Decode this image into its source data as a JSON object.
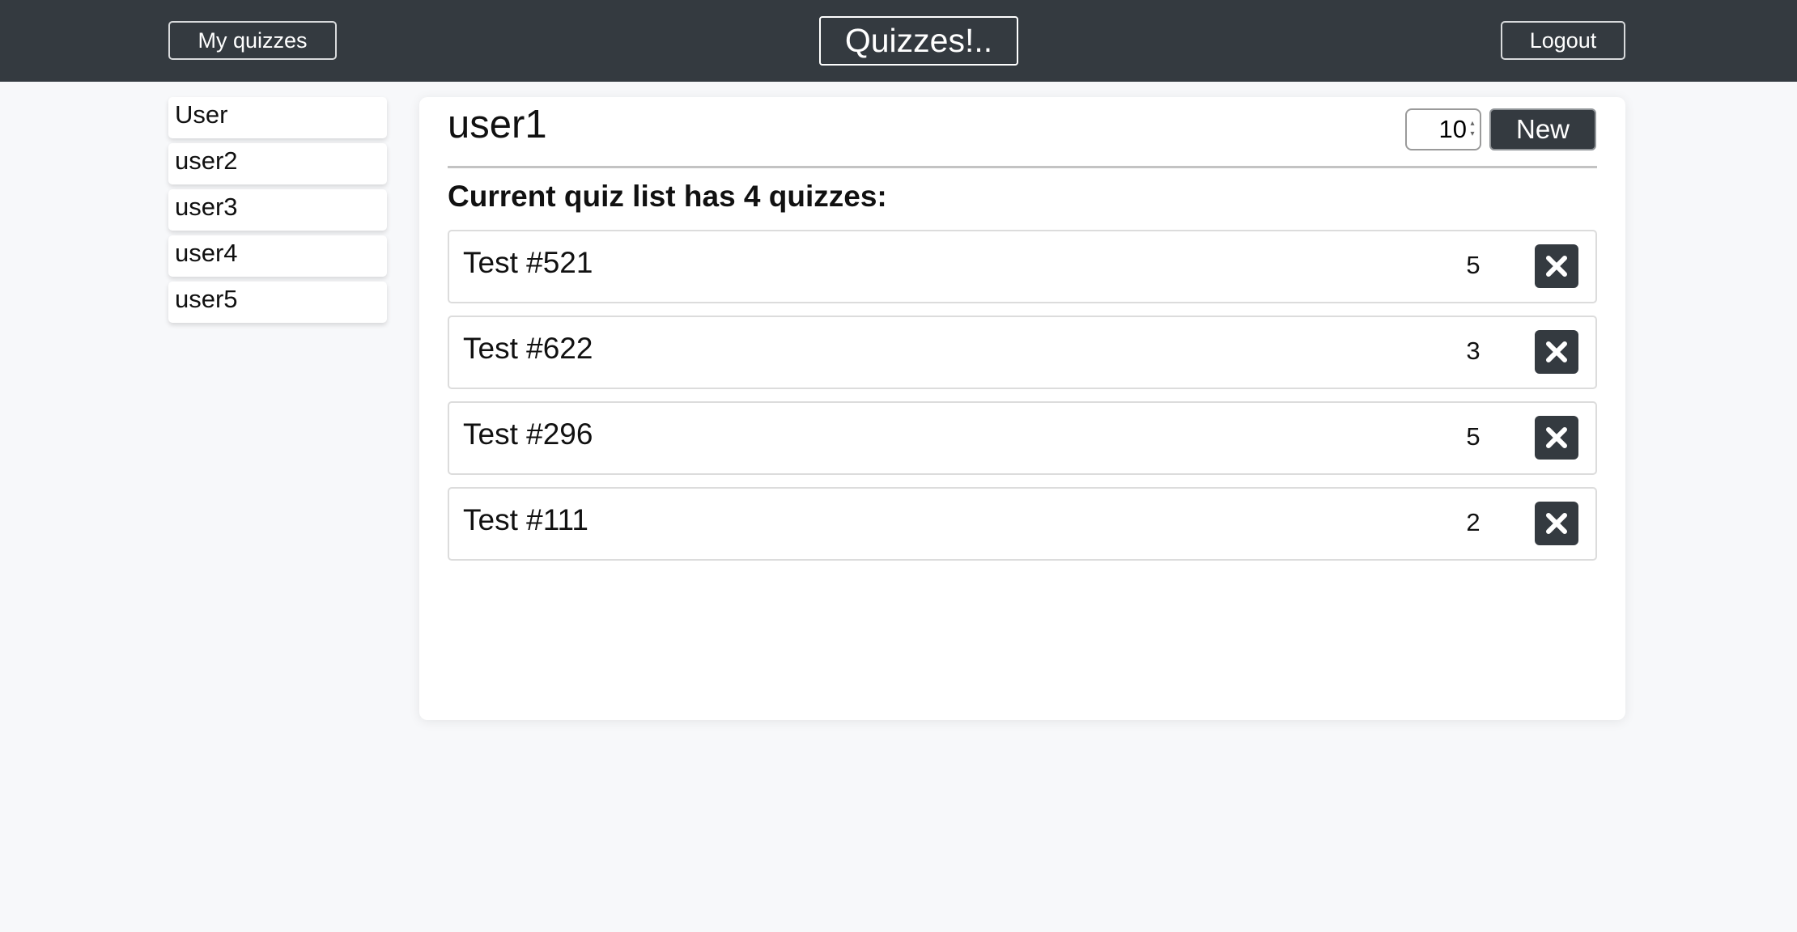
{
  "header": {
    "my_quizzes_label": "My quizzes",
    "brand": "Quizzes!..",
    "logout_label": "Logout"
  },
  "sidebar": {
    "items": [
      {
        "label": "User"
      },
      {
        "label": "user2"
      },
      {
        "label": "user3"
      },
      {
        "label": "user4"
      },
      {
        "label": "user5"
      }
    ]
  },
  "main": {
    "title": "user1",
    "count_input_value": "10",
    "new_label": "New",
    "list_heading": "Current quiz list has 4 quizzes:",
    "quizzes": [
      {
        "name": "Test #521",
        "count": "5"
      },
      {
        "name": "Test #622",
        "count": "3"
      },
      {
        "name": "Test #296",
        "count": "5"
      },
      {
        "name": "Test #111",
        "count": "2"
      }
    ]
  },
  "colors": {
    "header_bg": "#343a40",
    "page_bg": "#f7f8fa",
    "panel_bg": "#ffffff",
    "button_dark": "#343a40"
  },
  "icons": {
    "delete": "close-icon",
    "spinner": "spinner-arrows-icon"
  }
}
